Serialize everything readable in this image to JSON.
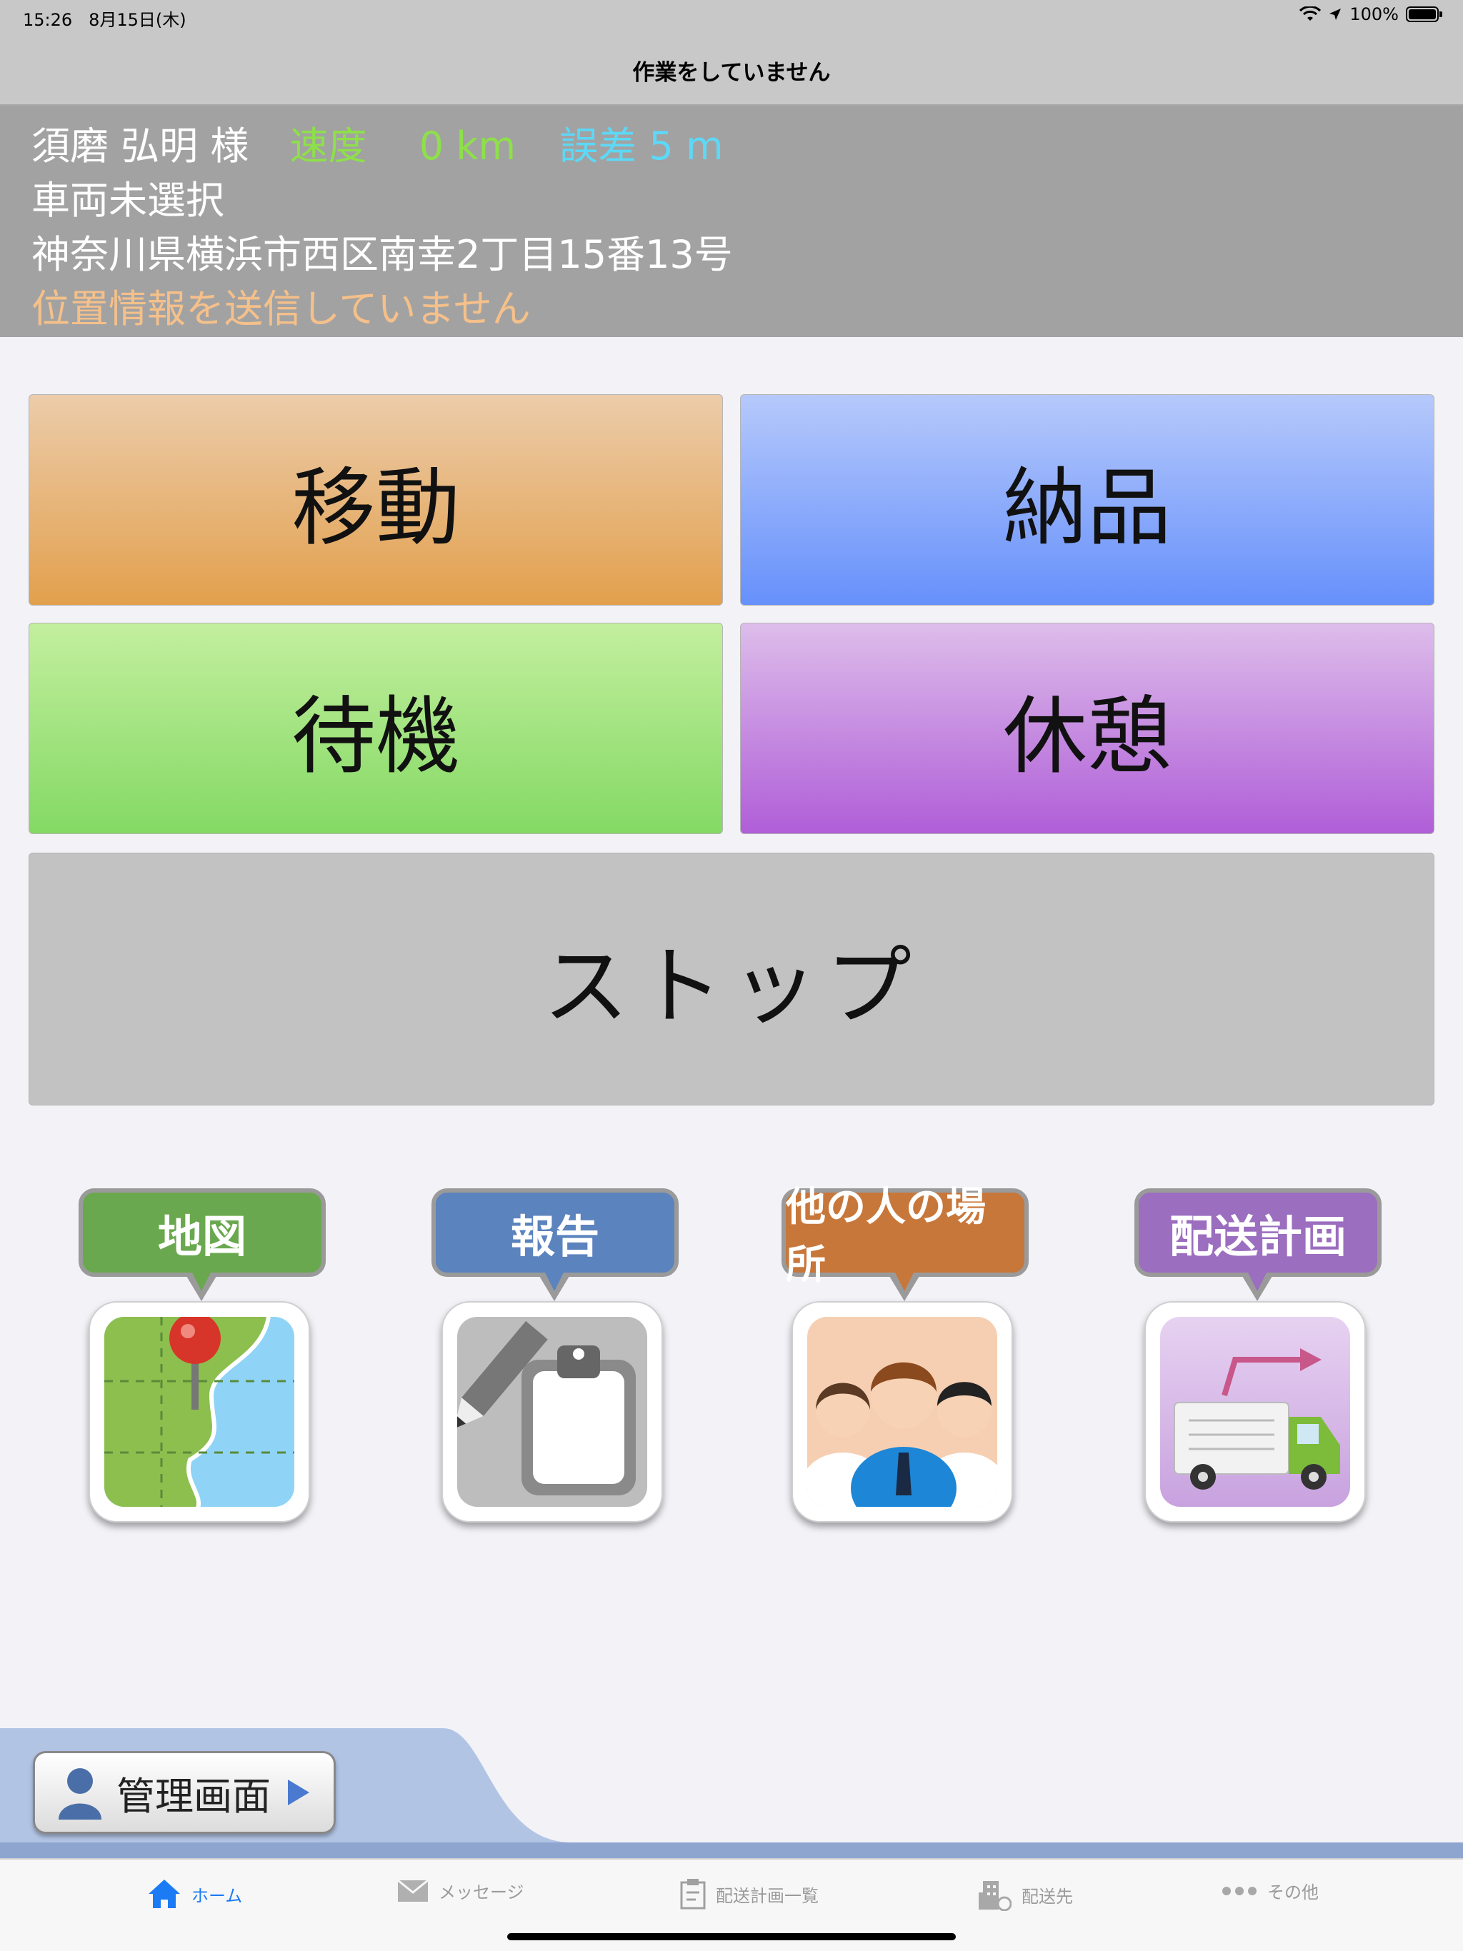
{
  "status_bar": {
    "time": "15:26",
    "date": "8月15日(木)",
    "battery": "100%"
  },
  "nav": {
    "title": "作業をしていません"
  },
  "info": {
    "driver": "須磨 弘明 様",
    "speed_label": "速度",
    "speed_value": "0 km",
    "error_label": "誤差 5 m",
    "vehicle": "車両未選択",
    "address": "神奈川県横浜市西区南幸2丁目15番13号",
    "location_status": "位置情報を送信していません"
  },
  "buttons": {
    "move": "移動",
    "deliver": "納品",
    "wait": "待機",
    "rest": "休憩",
    "stop": "ストップ"
  },
  "shortcuts": [
    {
      "label": "地図",
      "color": "#6aa84f"
    },
    {
      "label": "報告",
      "color": "#5b83bd"
    },
    {
      "label": "他の人の場所",
      "color": "#c8773a"
    },
    {
      "label": "配送計画",
      "color": "#9b6ebf"
    }
  ],
  "admin": {
    "label": "管理画面"
  },
  "tabs": [
    {
      "label": "ホーム",
      "icon": "house-icon",
      "active": true
    },
    {
      "label": "メッセージ",
      "icon": "envelope-icon"
    },
    {
      "label": "配送計画一覧",
      "icon": "clipboard-icon"
    },
    {
      "label": "配送先",
      "icon": "building-icon"
    },
    {
      "label": "その他",
      "icon": "more-icon"
    }
  ],
  "colors": {
    "speed": "#8ee04a",
    "error": "#5dd8f6",
    "warning": "#f5c08a",
    "tab_active": "#1b7bf5"
  }
}
